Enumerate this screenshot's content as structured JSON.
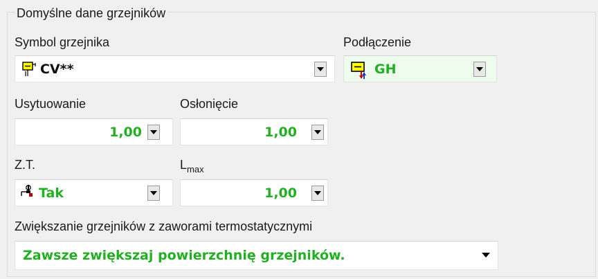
{
  "groupbox": {
    "title": "Domyślne dane grzejników"
  },
  "symbol": {
    "label": "Symbol grzejnika",
    "value": "CV**",
    "icon": "radiator-symbol-icon"
  },
  "connection": {
    "label": "Podłączenie",
    "value": "GH",
    "icon": "radiator-connection-icon"
  },
  "placement": {
    "label": "Usytuowanie",
    "value": "1,00"
  },
  "cover": {
    "label": "Osłonięcie",
    "value": "1,00"
  },
  "zt": {
    "label": "Z.T.",
    "value": "Tak",
    "icon": "thermostatic-valve-icon"
  },
  "lmax": {
    "label_main": "L",
    "label_sub": "max",
    "value": "1,00"
  },
  "increase": {
    "label": "Zwiększanie grzejników z zaworami termostatycznymi",
    "value": "Zawsze zwiększaj powierzchnię grzejników."
  },
  "colors": {
    "value_green": "#22b022",
    "connection_bg": "#eefcee"
  }
}
